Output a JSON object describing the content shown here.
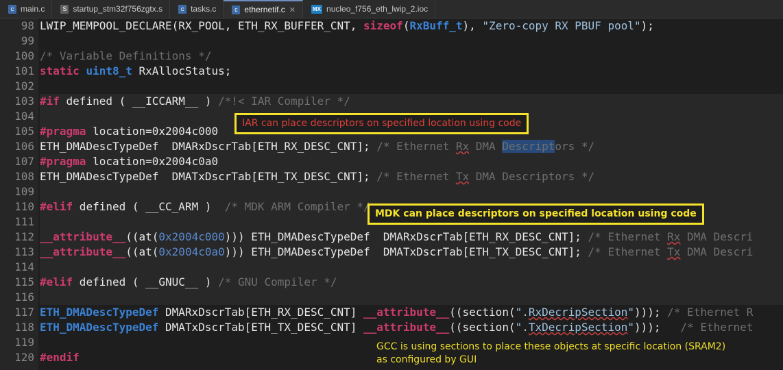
{
  "tabs": [
    {
      "label": "main.c",
      "icon": "c-file-icon"
    },
    {
      "label": "startup_stm32f756zgtx.s",
      "icon": "asm-file-icon"
    },
    {
      "label": "tasks.c",
      "icon": "c-file-icon"
    },
    {
      "label": "ethernetif.c",
      "icon": "c-file-icon",
      "active": true
    },
    {
      "label": "nucleo_f756_eth_lwip_2.ioc",
      "icon": "mx-file-icon",
      "mx": "MX"
    }
  ],
  "line_numbers": [
    "98",
    "99",
    "100",
    "101",
    "102",
    "103",
    "104",
    "105",
    "106",
    "107",
    "108",
    "109",
    "110",
    "111",
    "112",
    "113",
    "114",
    "115",
    "116",
    "117",
    "118",
    "119",
    "120"
  ],
  "code": {
    "l98": {
      "a": "LWIP_MEMPOOL_DECLARE(RX_POOL, ETH_RX_BUFFER_CNT, ",
      "kw": "sizeof",
      "b": "(",
      "ty": "RxBuff_t",
      "c": "), ",
      "s": "\"Zero-copy RX PBUF pool\"",
      "d": ");"
    },
    "l100": "/* Variable Definitions */",
    "l101": {
      "kw1": "static",
      "ty": "uint8_t",
      "rest": " RxAllocStatus;"
    },
    "l103": {
      "kw": "#if",
      "rest": " defined ( __ICCARM__ ) ",
      "cm": "/*!< IAR Compiler */"
    },
    "l105": {
      "kw": "#pragma",
      "rest": " location=0x2004c000"
    },
    "l106": {
      "rest": "ETH_DMADescTypeDef  DMARxDscrTab[ETH_RX_DESC_CNT]; ",
      "cm1": "/* Ethernet ",
      "cm2": "Rx",
      "cm3": " DMA ",
      "hl": "Descript",
      "cm4": "ors */"
    },
    "l107": {
      "kw": "#pragma",
      "rest": " location=0x2004c0a0"
    },
    "l108": {
      "rest": "ETH_DMADescTypeDef  DMATxDscrTab[ETH_TX_DESC_CNT]; ",
      "cm1": "/* Ethernet ",
      "cm2": "Tx",
      "cm3": " DMA Descriptors */"
    },
    "l110": {
      "kw": "#elif",
      "rest": " defined ( __CC_ARM )  ",
      "cm": "/* MDK ARM Compiler */"
    },
    "l112": {
      "kw": "__attribute__",
      "a": "((at(",
      "num": "0x2004c000",
      "b": "))) ETH_DMADescTypeDef  DMARxDscrTab[ETH_RX_DESC_CNT]; ",
      "cm1": "/* Ethernet ",
      "cm2": "Rx",
      "cm3": " DMA Descri"
    },
    "l113": {
      "kw": "__attribute__",
      "a": "((at(",
      "num": "0x2004c0a0",
      "b": "))) ETH_DMADescTypeDef  DMATxDscrTab[ETH_TX_DESC_CNT]; ",
      "cm1": "/* Ethernet ",
      "cm2": "Tx",
      "cm3": " DMA Descri"
    },
    "l115": {
      "kw": "#elif",
      "rest": " defined ( __GNUC__ ) ",
      "cm": "/* GNU Compiler */"
    },
    "l117": {
      "ty": "ETH_DMADescTypeDef",
      "a": " DMARxDscrTab[ETH_RX_DESC_CNT] ",
      "kw": "__attribute__",
      "b": "((section(",
      "s1": "\".",
      "s2": "RxDecripSection",
      "s3": "\"",
      "c": "))); ",
      "cm": "/* Ethernet R"
    },
    "l118": {
      "ty": "ETH_DMADescTypeDef",
      "a": " DMATxDscrTab[ETH_TX_DESC_CNT] ",
      "kw": "__attribute__",
      "b": "((section(",
      "s1": "\".",
      "s2": "TxDecripSection",
      "s3": "\"",
      "c": ")));   ",
      "cm": "/* Ethernet"
    },
    "l120": "#endif"
  },
  "annotations": {
    "iar": "IAR can place descriptors on specified location using code",
    "mdk": "MDK can place descriptors on specified location using code",
    "gcc_line1": "GCC is using sections to place these objects at specific location (SRAM2)",
    "gcc_line2": "as configured by GUI"
  },
  "colors": {
    "keyword": "#cc3b6e",
    "type": "#3b82d6",
    "comment": "#6f6f6f",
    "annotation_border": "#f5e22a",
    "iar_text": "#e0403a"
  }
}
